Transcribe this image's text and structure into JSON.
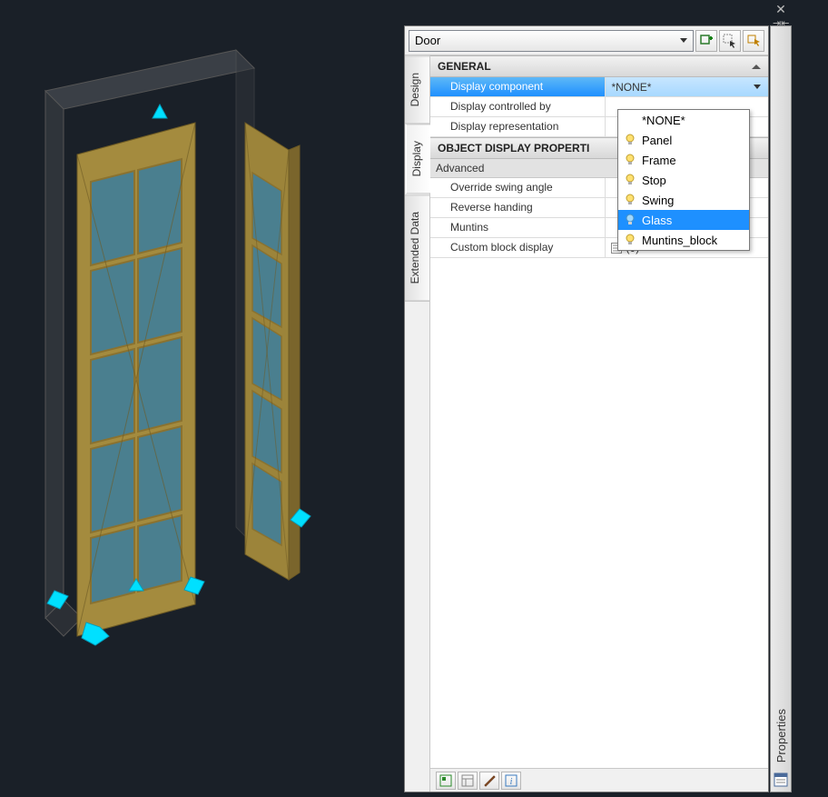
{
  "palette_title": "Properties",
  "object_type": "Door",
  "header_buttons": [
    "add-selection",
    "quick-select",
    "toggle-pickadd"
  ],
  "vtabs": [
    {
      "label": "Design",
      "id": "design"
    },
    {
      "label": "Display",
      "id": "display"
    },
    {
      "label": "Extended Data",
      "id": "extended-data"
    }
  ],
  "active_vtab": "display",
  "sections": {
    "general": {
      "title": "GENERAL",
      "rows": [
        {
          "name": "Display component",
          "value": "*NONE*",
          "type": "combo",
          "highlight": true
        },
        {
          "name": "Display controlled by",
          "value": ""
        },
        {
          "name": "Display representation",
          "value": ""
        }
      ]
    },
    "object_display": {
      "title": "OBJECT DISPLAY PROPERTI",
      "subtitle": "Advanced",
      "rows": [
        {
          "name": "Override swing angle",
          "value": ""
        },
        {
          "name": "Reverse handing",
          "value": ""
        },
        {
          "name": "Muntins",
          "value": ""
        },
        {
          "name": "Custom block display",
          "value": "(0)",
          "type": "list"
        }
      ]
    }
  },
  "dropdown": {
    "items": [
      {
        "label": "*NONE*",
        "bulb": false
      },
      {
        "label": "Panel",
        "bulb": true
      },
      {
        "label": "Frame",
        "bulb": true
      },
      {
        "label": "Stop",
        "bulb": true
      },
      {
        "label": "Swing",
        "bulb": true
      },
      {
        "label": "Glass",
        "bulb": true,
        "selected": true
      },
      {
        "label": "Muntins_block",
        "bulb": true
      }
    ]
  },
  "footer_buttons": [
    "object-viewer",
    "preview",
    "brush",
    "info"
  ],
  "strip_icon": "properties-icon",
  "top_controls": [
    "close",
    "autohide",
    "menu"
  ]
}
